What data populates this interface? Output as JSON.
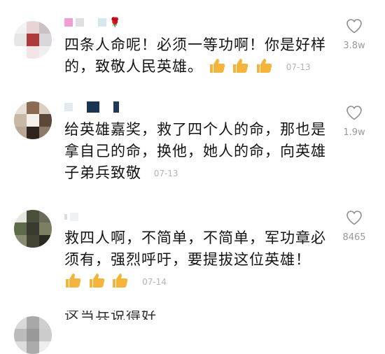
{
  "comments": [
    {
      "text": "四条人命呢！必须一等功啊！你是好样的，致敬人民英雄。",
      "date": "07-13",
      "likes": "3.8w",
      "thumbs": 3
    },
    {
      "text": "给英雄嘉奖，救了四个人的命，那也是拿自己的命，换他，她人的命，向英雄子弟兵致敬",
      "date": "07-13",
      "likes": "1.9w",
      "thumbs": 0
    },
    {
      "text": "救四人啊，不简单，不简单，军功章必须有，强烈呼吁，要提拔这位英雄！",
      "date": "07-14",
      "likes": "8465",
      "thumbs": 3
    }
  ],
  "partial_comment": {
    "text": "这当兵说得好"
  },
  "icons": {
    "like": "heart-outline-icon",
    "emoji": "thumbs-up-emoji-icon"
  },
  "colors": {
    "thumb": "#f4b43b",
    "date": "#b4b4b4",
    "count": "#999999"
  }
}
